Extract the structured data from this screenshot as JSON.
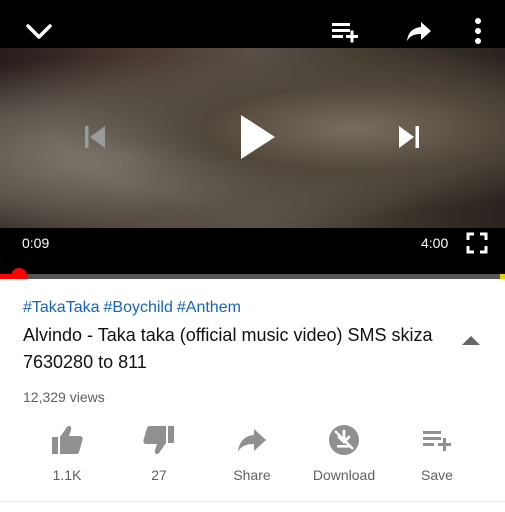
{
  "player": {
    "current_time": "0:09",
    "duration": "4:00",
    "progress_fraction": 0.0375,
    "buffered_fraction": 1.0
  },
  "video": {
    "hashtags": [
      "#TakaTaka",
      "#Boychild",
      "#Anthem"
    ],
    "title": "Alvindo - Taka taka (official music video) SMS skiza 7630280 to 811",
    "views": "12,329 views"
  },
  "actions": {
    "like_count": "1.1K",
    "dislike_count": "27",
    "share_label": "Share",
    "download_label": "Download",
    "save_label": "Save"
  },
  "colors": {
    "accent": "#ff0000",
    "hashtag": "#1565c0",
    "icon_gray": "#909090"
  }
}
